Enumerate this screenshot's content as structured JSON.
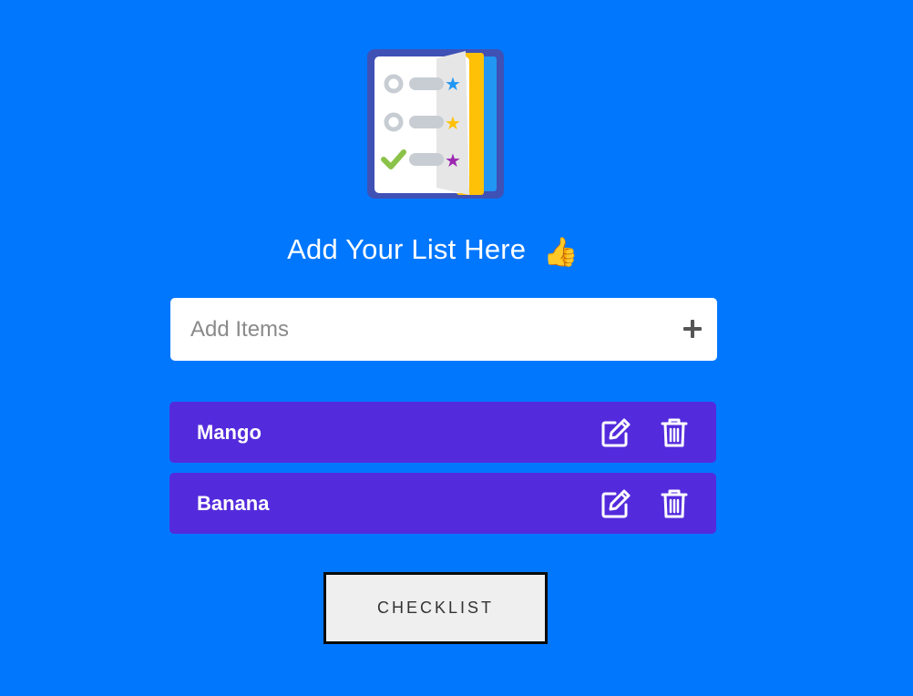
{
  "header": {
    "title": "Add Your List Here",
    "emoji": "👍"
  },
  "add_form": {
    "placeholder": "Add Items",
    "value": ""
  },
  "items": [
    {
      "label": "Mango"
    },
    {
      "label": "Banana"
    }
  ],
  "checklist_button": {
    "label": "CHECKLIST"
  },
  "colors": {
    "background": "#0177fe",
    "item_background": "#542bdc",
    "logo_frame": "#3f51b5"
  },
  "icons": {
    "logo": "checklist-book-icon",
    "add": "plus-icon",
    "edit": "edit-icon",
    "delete": "trash-icon",
    "thumbs": "thumbs-up-icon"
  }
}
